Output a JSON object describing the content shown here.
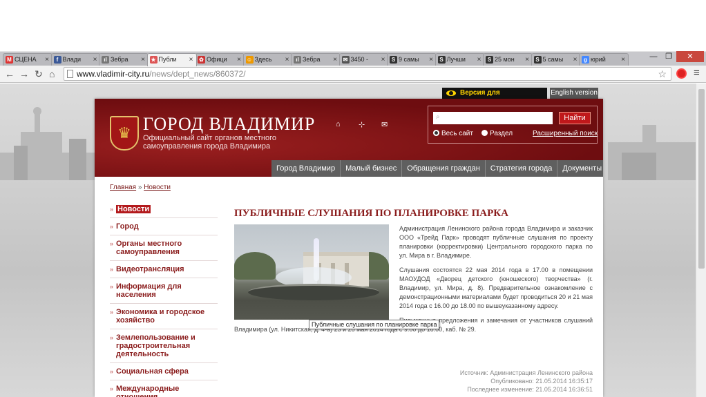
{
  "browser": {
    "tabs": [
      {
        "label": "СЦЕНА",
        "favicon": "M",
        "favcolor": "#d33"
      },
      {
        "label": "Влади",
        "favicon": "f",
        "favcolor": "#3b5998"
      },
      {
        "label": "Зебра",
        "favicon": "ıl",
        "favcolor": "#777"
      },
      {
        "label": "Публи",
        "favicon": "★",
        "favcolor": "#d55",
        "active": true
      },
      {
        "label": "Офици",
        "favicon": "✿",
        "favcolor": "#c33"
      },
      {
        "label": "Здесь",
        "favicon": "☺",
        "favcolor": "#e90"
      },
      {
        "label": "Зебра",
        "favicon": "ıl",
        "favcolor": "#777"
      },
      {
        "label": "3450 -",
        "favicon": "✉",
        "favcolor": "#555"
      },
      {
        "label": "9 самы",
        "favicon": "S",
        "favcolor": "#333"
      },
      {
        "label": "Лучши",
        "favicon": "S",
        "favcolor": "#333"
      },
      {
        "label": "25 мон",
        "favicon": "S",
        "favcolor": "#333"
      },
      {
        "label": "5 самы",
        "favicon": "S",
        "favcolor": "#333"
      },
      {
        "label": "юрий",
        "favicon": "g",
        "favcolor": "#48f"
      }
    ],
    "url_host": "www.vladimir-city.ru",
    "url_path": "/news/dept_news/860372/"
  },
  "site": {
    "accessibility": "Версия для слабовидящих",
    "english": "English version",
    "title": "ГОРОД ВЛАДИМИР",
    "subtitle": "Официальный сайт органов местного самоуправления города Владимира",
    "header_icons": [
      "home-icon",
      "sitemap-icon",
      "mail-icon"
    ],
    "search": {
      "placeholder": "",
      "button": "Найти",
      "opt_all": "Весь сайт",
      "opt_section": "Раздел",
      "advanced": "Расширенный поиск"
    },
    "nav": [
      "Город Владимир",
      "Малый бизнес",
      "Обращения граждан",
      "Стратегия города",
      "Документы"
    ]
  },
  "breadcrumb": {
    "home": "Главная",
    "sep": "»",
    "current": "Новости"
  },
  "sidebar": [
    {
      "label": "Новости",
      "active": true
    },
    {
      "label": "Город"
    },
    {
      "label": "Органы местного самоуправления"
    },
    {
      "label": "Видеотрансляция"
    },
    {
      "label": "Информация для населения"
    },
    {
      "label": "Экономика и городское хозяйство"
    },
    {
      "label": "Землепользование и градостроительная деятельность"
    },
    {
      "label": "Социальная сфера"
    },
    {
      "label": "Международные отношения"
    }
  ],
  "article": {
    "title": "ПУБЛИЧНЫЕ СЛУШАНИЯ ПО ПЛАНИРОВКЕ ПАРКА",
    "p1": "Администрация Ленинского района города Владимира и заказчик ООО «Трейд Парк» проводят публичные слушания по проекту планировки (корректировки) Центрального городского парка по ул. Мира в г. Владимире.",
    "p2": "Слушания состоятся 22 мая 2014 года в 17.00 в помещении МАОУДОД «Дворец детского (юношеского) творчества» (г. Владимир, ул. Мира, д. 8). Предварительное ознакомление с демонстрационными материалами будет проводиться 20 и 21 мая 2014 года с 16.00 до 18.00 по вышеуказанному адресу.",
    "p3": "Письменные предложения и замечания от участников слушаний принимаются в администрации Ленинского района города Владимира (ул. Никитская, д. 4-а) 23 и 26 мая 2014 года с 9.00 до 16.00, каб. № 29.",
    "tooltip": "Публичные слушания по планировке парка",
    "source": "Источник:  Администрация Ленинского района",
    "published": "Опубликовано: 21.05.2014 16:35:17",
    "modified": "Последнее изменение: 21.05.2014 16:36:51"
  }
}
